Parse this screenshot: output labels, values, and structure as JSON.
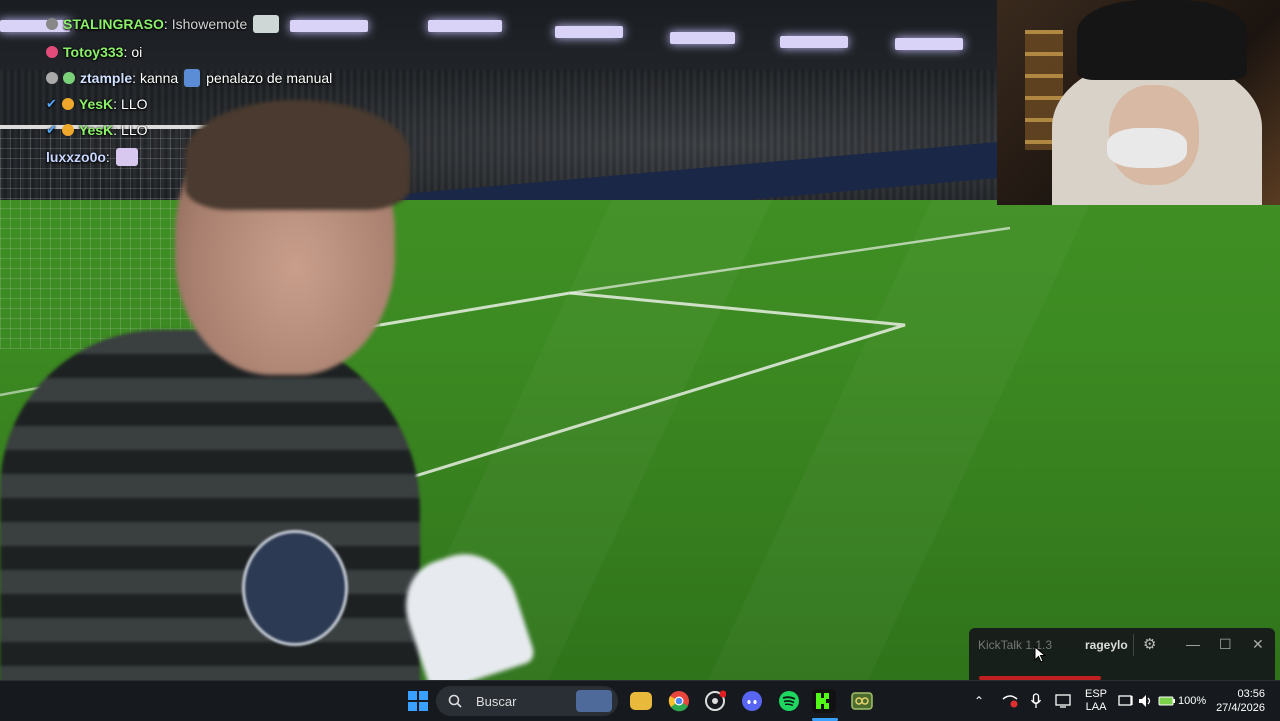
{
  "chat": {
    "lines": [
      {
        "user": "STALINGRASO",
        "sep": ":",
        "msg": "Ishowemote",
        "user_color": "#8cf06a"
      },
      {
        "user": "Totoy333",
        "sep": ":",
        "msg": "oi",
        "user_color": "#8cf06a"
      },
      {
        "user": "ztample",
        "sep": ":",
        "msg": "kanna",
        "msg2": "penalazo de manual",
        "user_color": "#d0e0ff"
      },
      {
        "user": "YesK",
        "sep": ":",
        "msg": "LLO",
        "user_color": "#8cf06a"
      },
      {
        "user": "YesK",
        "sep": ":",
        "msg": "LLO",
        "user_color": "#8cf06a"
      },
      {
        "user": "luxxzo0o",
        "sep": ":",
        "msg": "",
        "user_color": "#c9d6ff"
      }
    ]
  },
  "kicktalk": {
    "title": "KickTalk 1.1.3",
    "username": "rageylo",
    "gear": "⚙",
    "minimize": "—",
    "maximize": "☐",
    "close": "✕"
  },
  "taskbar": {
    "search_placeholder": "Buscar",
    "lang_top": "ESP",
    "lang_bottom": "LAA",
    "battery": "100%",
    "time": "03:56",
    "date": "27/4/2026"
  },
  "colors": {
    "taskbar_bg": "#161a1e",
    "kick_green": "#53fc18",
    "accent_blue": "#0a84ff"
  }
}
